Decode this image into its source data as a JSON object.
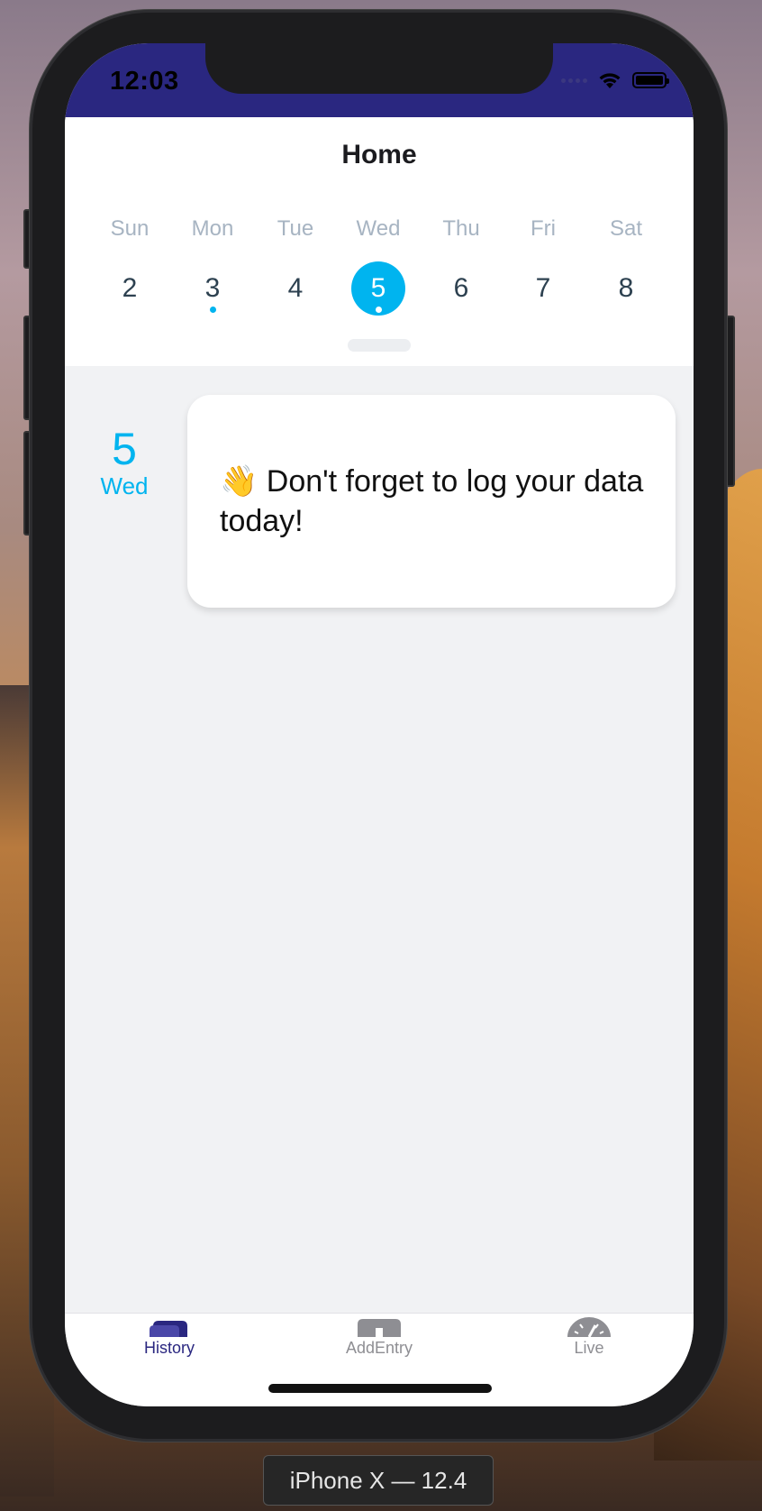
{
  "status_bar": {
    "time": "12:03",
    "icons": [
      "cellular-signal-icon",
      "wifi-icon",
      "battery-icon"
    ],
    "background_color": "#2a2780"
  },
  "header": {
    "title": "Home"
  },
  "calendar": {
    "days": [
      {
        "name": "Sun",
        "number": "2",
        "selected": false,
        "has_event": false
      },
      {
        "name": "Mon",
        "number": "3",
        "selected": false,
        "has_event": true
      },
      {
        "name": "Tue",
        "number": "4",
        "selected": false,
        "has_event": false
      },
      {
        "name": "Wed",
        "number": "5",
        "selected": true,
        "has_event": true
      },
      {
        "name": "Thu",
        "number": "6",
        "selected": false,
        "has_event": false
      },
      {
        "name": "Fri",
        "number": "7",
        "selected": false,
        "has_event": false
      },
      {
        "name": "Sat",
        "number": "8",
        "selected": false,
        "has_event": false
      }
    ],
    "accent_color": "#00b4ef"
  },
  "agenda": {
    "day_number": "5",
    "day_name": "Wed",
    "card_text": "👋 Don't forget to log your data today!"
  },
  "tabbar": {
    "tabs": [
      {
        "label": "History",
        "icon": "history-icon",
        "active": true,
        "color": "#2a2780"
      },
      {
        "label": "AddEntry",
        "icon": "add-entry-icon",
        "active": false,
        "color": "#8e8e93"
      },
      {
        "label": "Live",
        "icon": "live-gauge-icon",
        "active": false,
        "color": "#8e8e93"
      }
    ]
  },
  "device_label": "iPhone X — 12.4"
}
